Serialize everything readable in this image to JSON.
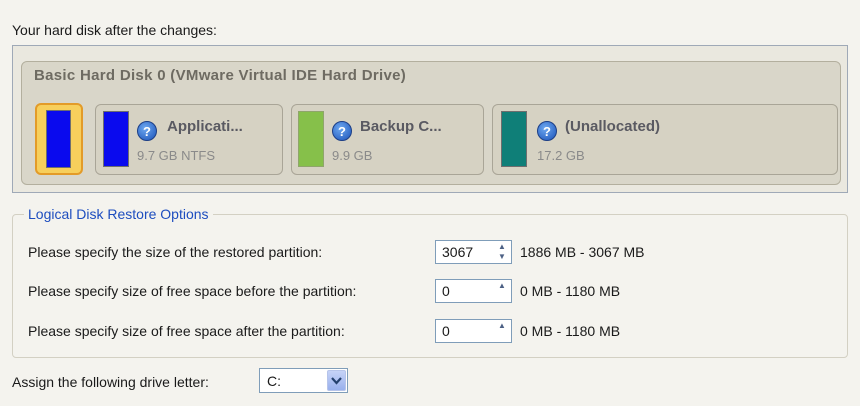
{
  "header": {
    "title": "Your hard disk after the changes:"
  },
  "disk": {
    "name": "Basic Hard Disk 0 (VMware Virtual IDE Hard Drive)",
    "partitions": [
      {
        "label": "Applicati...",
        "details": "9.7 GB NTFS",
        "color": "#0a0aee"
      },
      {
        "label": "Backup C...",
        "details": "9.9 GB",
        "color": "#86c04a"
      },
      {
        "label": "(Unallocated)",
        "details": "17.2 GB",
        "color": "#0f7f78"
      }
    ],
    "selected_color": "#0a0aee",
    "selected_highlight": "#f7cf5c"
  },
  "options": {
    "group_title": "Logical Disk Restore Options",
    "rows": [
      {
        "label": "Please specify the size of the restored partition:",
        "value": "3067",
        "range": "1886 MB - 3067 MB"
      },
      {
        "label": "Please specify size of free space before the partition:",
        "value": "0",
        "range": "0 MB - 1180 MB"
      },
      {
        "label": "Please specify size of free space after the partition:",
        "value": "0",
        "range": "0 MB - 1180 MB"
      }
    ]
  },
  "drive": {
    "label": "Assign the following drive letter:",
    "value": "C:"
  },
  "icons": {
    "help": "question-circle-icon",
    "spin_up": "spin-up-arrow-icon",
    "spin_down": "spin-down-arrow-icon",
    "dropdown": "chevron-down-icon"
  }
}
